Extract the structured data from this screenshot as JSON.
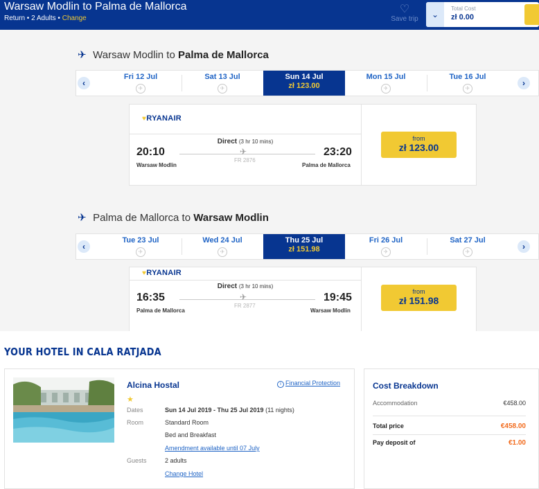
{
  "header": {
    "title": "Warsaw Modlin to Palma de Mallorca",
    "subtitle": "Return • 2 Adults • ",
    "change_link": "Change",
    "save_trip": "Save trip",
    "total_cost_label": "Total Cost",
    "total_cost_value": "zł 0.00"
  },
  "outbound": {
    "route_prefix": "Warsaw Modlin to ",
    "route_dest": "Palma de Mallorca",
    "dates": [
      {
        "label": "Fri 12 Jul",
        "price": ""
      },
      {
        "label": "Sat 13 Jul",
        "price": ""
      },
      {
        "label": "Sun 14 Jul",
        "price": "zł 123.00"
      },
      {
        "label": "Mon 15 Jul",
        "price": ""
      },
      {
        "label": "Tue 16 Jul",
        "price": ""
      }
    ],
    "airline": "RYANAIR",
    "direct": "Direct",
    "duration": "(3 hr 10 mins)",
    "dep_time": "20:10",
    "arr_time": "23:20",
    "dep_airport": "Warsaw Modlin",
    "arr_airport": "Palma de Mallorca",
    "flight_no": "FR 2876",
    "from_label": "from",
    "price": "zł 123.00"
  },
  "inbound": {
    "route_prefix": "Palma de Mallorca to ",
    "route_dest": "Warsaw Modlin",
    "dates": [
      {
        "label": "Tue 23 Jul",
        "price": ""
      },
      {
        "label": "Wed 24 Jul",
        "price": ""
      },
      {
        "label": "Thu 25 Jul",
        "price": "zł 151.98"
      },
      {
        "label": "Fri 26 Jul",
        "price": ""
      },
      {
        "label": "Sat 27 Jul",
        "price": ""
      }
    ],
    "airline": "RYANAIR",
    "direct": "Direct",
    "duration": "(3 hr 10 mins)",
    "dep_time": "16:35",
    "arr_time": "19:45",
    "dep_airport": "Palma de Mallorca",
    "arr_airport": "Warsaw Modlin",
    "flight_no": "FR 2877",
    "from_label": "from",
    "price": "zł 151.98"
  },
  "hotel": {
    "heading": "YOUR HOTEL IN CALA RATJADA",
    "name": "Alcina Hostal",
    "financial_protection": "Financial Protection",
    "stars": "★",
    "dates_label": "Dates",
    "dates_value": "Sun 14 Jul 2019 - Thu 25 Jul 2019",
    "nights": " (11 nights)",
    "room_label": "Room",
    "room_value": "Standard Room",
    "board_value": "Bed and Breakfast",
    "amendment_link": "Amendment available until 07 July",
    "guests_label": "Guests",
    "guests_value": "2 adults",
    "change_hotel": "Change Hotel"
  },
  "cost_breakdown": {
    "title": "Cost Breakdown",
    "accommodation_label": "Accommodation",
    "accommodation_value": "€458.00",
    "total_label": "Total price",
    "total_value": "€458.00",
    "deposit_label": "Pay deposit of",
    "deposit_value": "€1.00"
  },
  "colors": {
    "brand_blue": "#073590",
    "accent_yellow": "#f1c933",
    "price_orange": "#f26b1d",
    "link_blue": "#1e63c5"
  }
}
